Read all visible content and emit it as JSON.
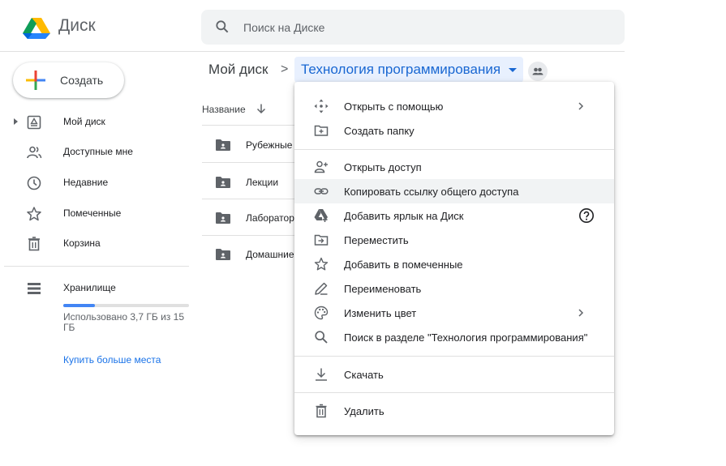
{
  "header": {
    "brand": "Диск",
    "search_placeholder": "Поиск на Диске"
  },
  "sidebar": {
    "create_label": "Создать",
    "items": [
      {
        "label": "Мой диск",
        "icon": "my-drive-icon"
      },
      {
        "label": "Доступные мне",
        "icon": "shared-with-me-icon"
      },
      {
        "label": "Недавние",
        "icon": "clock-icon"
      },
      {
        "label": "Помеченные",
        "icon": "star-icon"
      },
      {
        "label": "Корзина",
        "icon": "trash-icon"
      }
    ],
    "storage": {
      "label": "Хранилище",
      "used_text": "Использовано 3,7 ГБ из 15 ГБ",
      "used_fraction": 0.25,
      "buy_label": "Купить больше места"
    }
  },
  "breadcrumb": {
    "root": "Мой диск",
    "separator": ">",
    "current": "Технология программирования"
  },
  "file_list": {
    "column_name": "Название",
    "rows": [
      {
        "name": "Рубежные"
      },
      {
        "name": "Лекции"
      },
      {
        "name": "Лабораторные"
      },
      {
        "name": "Домашние"
      }
    ]
  },
  "context_menu": {
    "items": [
      {
        "label": "Открыть с помощью",
        "icon": "move-arrows-icon",
        "submenu": true
      },
      {
        "label": "Создать папку",
        "icon": "new-folder-icon"
      },
      {
        "label": "Открыть доступ",
        "icon": "add-person-icon"
      },
      {
        "label": "Копировать ссылку общего доступа",
        "icon": "link-icon",
        "highlighted": true
      },
      {
        "label": "Добавить ярлык на Диск",
        "icon": "drive-shortcut-icon",
        "help": true
      },
      {
        "label": "Переместить",
        "icon": "move-to-folder-icon"
      },
      {
        "label": "Добавить в помеченные",
        "icon": "star-icon"
      },
      {
        "label": "Переименовать",
        "icon": "pencil-icon"
      },
      {
        "label": "Изменить цвет",
        "icon": "palette-icon",
        "submenu": true
      },
      {
        "label": "Поиск в разделе \"Технология программирования\"",
        "icon": "search-icon"
      },
      {
        "label": "Скачать",
        "icon": "download-icon"
      },
      {
        "label": "Удалить",
        "icon": "trash-icon"
      }
    ]
  },
  "colors": {
    "accent": "#1a73e8",
    "breadcrumb_highlight": "#e8f0fe",
    "menu_hover": "#f1f3f4"
  }
}
